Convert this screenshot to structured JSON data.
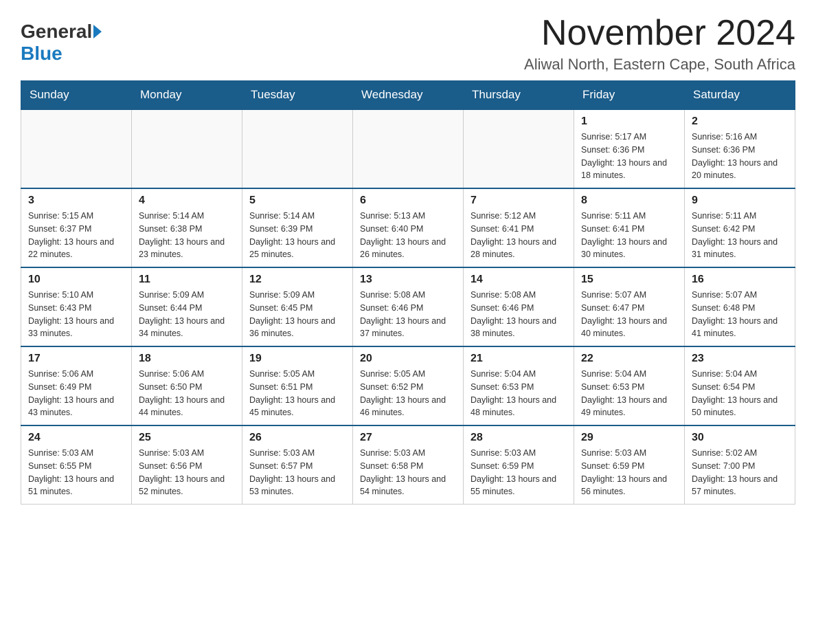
{
  "logo": {
    "general": "General",
    "blue": "Blue"
  },
  "header": {
    "month_year": "November 2024",
    "location": "Aliwal North, Eastern Cape, South Africa"
  },
  "weekdays": [
    "Sunday",
    "Monday",
    "Tuesday",
    "Wednesday",
    "Thursday",
    "Friday",
    "Saturday"
  ],
  "weeks": [
    [
      {
        "day": "",
        "sunrise": "",
        "sunset": "",
        "daylight": ""
      },
      {
        "day": "",
        "sunrise": "",
        "sunset": "",
        "daylight": ""
      },
      {
        "day": "",
        "sunrise": "",
        "sunset": "",
        "daylight": ""
      },
      {
        "day": "",
        "sunrise": "",
        "sunset": "",
        "daylight": ""
      },
      {
        "day": "",
        "sunrise": "",
        "sunset": "",
        "daylight": ""
      },
      {
        "day": "1",
        "sunrise": "Sunrise: 5:17 AM",
        "sunset": "Sunset: 6:36 PM",
        "daylight": "Daylight: 13 hours and 18 minutes."
      },
      {
        "day": "2",
        "sunrise": "Sunrise: 5:16 AM",
        "sunset": "Sunset: 6:36 PM",
        "daylight": "Daylight: 13 hours and 20 minutes."
      }
    ],
    [
      {
        "day": "3",
        "sunrise": "Sunrise: 5:15 AM",
        "sunset": "Sunset: 6:37 PM",
        "daylight": "Daylight: 13 hours and 22 minutes."
      },
      {
        "day": "4",
        "sunrise": "Sunrise: 5:14 AM",
        "sunset": "Sunset: 6:38 PM",
        "daylight": "Daylight: 13 hours and 23 minutes."
      },
      {
        "day": "5",
        "sunrise": "Sunrise: 5:14 AM",
        "sunset": "Sunset: 6:39 PM",
        "daylight": "Daylight: 13 hours and 25 minutes."
      },
      {
        "day": "6",
        "sunrise": "Sunrise: 5:13 AM",
        "sunset": "Sunset: 6:40 PM",
        "daylight": "Daylight: 13 hours and 26 minutes."
      },
      {
        "day": "7",
        "sunrise": "Sunrise: 5:12 AM",
        "sunset": "Sunset: 6:41 PM",
        "daylight": "Daylight: 13 hours and 28 minutes."
      },
      {
        "day": "8",
        "sunrise": "Sunrise: 5:11 AM",
        "sunset": "Sunset: 6:41 PM",
        "daylight": "Daylight: 13 hours and 30 minutes."
      },
      {
        "day": "9",
        "sunrise": "Sunrise: 5:11 AM",
        "sunset": "Sunset: 6:42 PM",
        "daylight": "Daylight: 13 hours and 31 minutes."
      }
    ],
    [
      {
        "day": "10",
        "sunrise": "Sunrise: 5:10 AM",
        "sunset": "Sunset: 6:43 PM",
        "daylight": "Daylight: 13 hours and 33 minutes."
      },
      {
        "day": "11",
        "sunrise": "Sunrise: 5:09 AM",
        "sunset": "Sunset: 6:44 PM",
        "daylight": "Daylight: 13 hours and 34 minutes."
      },
      {
        "day": "12",
        "sunrise": "Sunrise: 5:09 AM",
        "sunset": "Sunset: 6:45 PM",
        "daylight": "Daylight: 13 hours and 36 minutes."
      },
      {
        "day": "13",
        "sunrise": "Sunrise: 5:08 AM",
        "sunset": "Sunset: 6:46 PM",
        "daylight": "Daylight: 13 hours and 37 minutes."
      },
      {
        "day": "14",
        "sunrise": "Sunrise: 5:08 AM",
        "sunset": "Sunset: 6:46 PM",
        "daylight": "Daylight: 13 hours and 38 minutes."
      },
      {
        "day": "15",
        "sunrise": "Sunrise: 5:07 AM",
        "sunset": "Sunset: 6:47 PM",
        "daylight": "Daylight: 13 hours and 40 minutes."
      },
      {
        "day": "16",
        "sunrise": "Sunrise: 5:07 AM",
        "sunset": "Sunset: 6:48 PM",
        "daylight": "Daylight: 13 hours and 41 minutes."
      }
    ],
    [
      {
        "day": "17",
        "sunrise": "Sunrise: 5:06 AM",
        "sunset": "Sunset: 6:49 PM",
        "daylight": "Daylight: 13 hours and 43 minutes."
      },
      {
        "day": "18",
        "sunrise": "Sunrise: 5:06 AM",
        "sunset": "Sunset: 6:50 PM",
        "daylight": "Daylight: 13 hours and 44 minutes."
      },
      {
        "day": "19",
        "sunrise": "Sunrise: 5:05 AM",
        "sunset": "Sunset: 6:51 PM",
        "daylight": "Daylight: 13 hours and 45 minutes."
      },
      {
        "day": "20",
        "sunrise": "Sunrise: 5:05 AM",
        "sunset": "Sunset: 6:52 PM",
        "daylight": "Daylight: 13 hours and 46 minutes."
      },
      {
        "day": "21",
        "sunrise": "Sunrise: 5:04 AM",
        "sunset": "Sunset: 6:53 PM",
        "daylight": "Daylight: 13 hours and 48 minutes."
      },
      {
        "day": "22",
        "sunrise": "Sunrise: 5:04 AM",
        "sunset": "Sunset: 6:53 PM",
        "daylight": "Daylight: 13 hours and 49 minutes."
      },
      {
        "day": "23",
        "sunrise": "Sunrise: 5:04 AM",
        "sunset": "Sunset: 6:54 PM",
        "daylight": "Daylight: 13 hours and 50 minutes."
      }
    ],
    [
      {
        "day": "24",
        "sunrise": "Sunrise: 5:03 AM",
        "sunset": "Sunset: 6:55 PM",
        "daylight": "Daylight: 13 hours and 51 minutes."
      },
      {
        "day": "25",
        "sunrise": "Sunrise: 5:03 AM",
        "sunset": "Sunset: 6:56 PM",
        "daylight": "Daylight: 13 hours and 52 minutes."
      },
      {
        "day": "26",
        "sunrise": "Sunrise: 5:03 AM",
        "sunset": "Sunset: 6:57 PM",
        "daylight": "Daylight: 13 hours and 53 minutes."
      },
      {
        "day": "27",
        "sunrise": "Sunrise: 5:03 AM",
        "sunset": "Sunset: 6:58 PM",
        "daylight": "Daylight: 13 hours and 54 minutes."
      },
      {
        "day": "28",
        "sunrise": "Sunrise: 5:03 AM",
        "sunset": "Sunset: 6:59 PM",
        "daylight": "Daylight: 13 hours and 55 minutes."
      },
      {
        "day": "29",
        "sunrise": "Sunrise: 5:03 AM",
        "sunset": "Sunset: 6:59 PM",
        "daylight": "Daylight: 13 hours and 56 minutes."
      },
      {
        "day": "30",
        "sunrise": "Sunrise: 5:02 AM",
        "sunset": "Sunset: 7:00 PM",
        "daylight": "Daylight: 13 hours and 57 minutes."
      }
    ]
  ]
}
